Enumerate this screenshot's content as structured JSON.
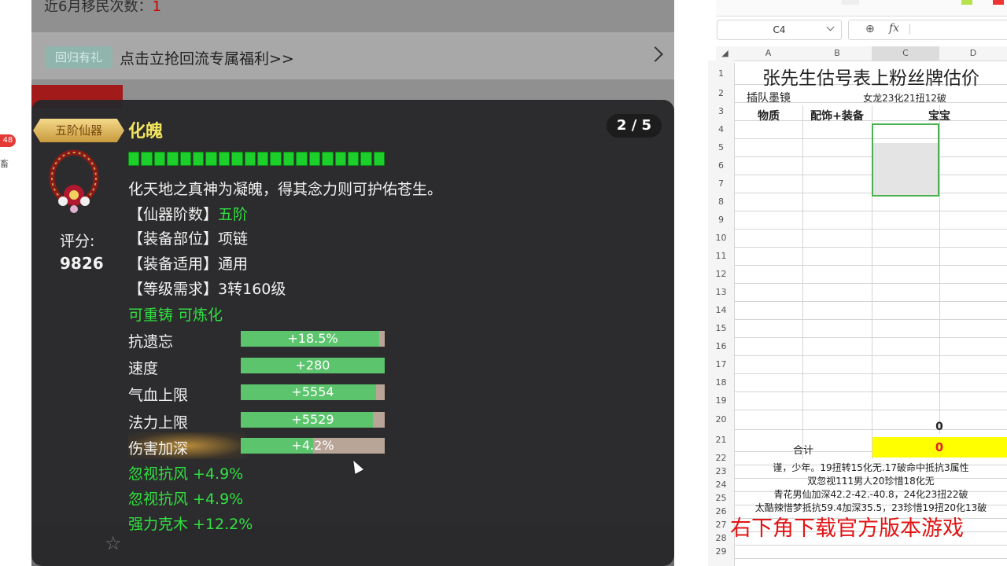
{
  "left_strip": {
    "badge": "48",
    "glyph": "畜"
  },
  "game_page": {
    "migrate_label": "近6月移民次数：",
    "migrate_value": "1",
    "return_tag": "回归有礼",
    "return_text": "点击立抢回流专属福利>>"
  },
  "tooltip": {
    "tier": "五阶仙器",
    "name": "化魄",
    "page": "2 / 5",
    "pip_count": 20,
    "description": "化天地之真神为凝魄，得其念力则可护佑苍生。",
    "score_label": "评分:",
    "score_value": "9826",
    "attributes": [
      {
        "label": "【仙器阶数】",
        "value": "五阶"
      },
      {
        "label": "【装备部位】",
        "value": "项链"
      },
      {
        "label": "【装备适用】",
        "value": "通用"
      },
      {
        "label": "【等级需求】",
        "value": "3转160级"
      }
    ],
    "recast": "可重铸 可炼化",
    "stats": [
      {
        "name": "抗遗忘",
        "value": "+18.5%",
        "fill": 0.96
      },
      {
        "name": "速度",
        "value": "+280",
        "fill": 1.0
      },
      {
        "name": "气血上限",
        "value": "+5554",
        "fill": 0.94
      },
      {
        "name": "法力上限",
        "value": "+5529",
        "fill": 0.92
      },
      {
        "name": "伤害加深",
        "value": "+4.2%",
        "fill": 0.5
      }
    ],
    "specials": [
      "忽视抗风 +4.9%",
      "忽视抗风 +4.9%",
      "强力克木 +12.2%"
    ],
    "colors": {
      "name": "#f2e55c",
      "green": "#30e040",
      "bar": "#5bc46c"
    }
  },
  "spreadsheet": {
    "name_box": "C4",
    "columns": [
      "A",
      "B",
      "C",
      "D"
    ],
    "rows": [
      "1",
      "2",
      "3",
      "4",
      "5",
      "6",
      "7",
      "8",
      "9",
      "10",
      "11",
      "12",
      "13",
      "14",
      "15",
      "16",
      "17",
      "18",
      "19",
      "20",
      "21",
      "22",
      "23",
      "24",
      "25",
      "26",
      "27",
      "28",
      "29"
    ],
    "title": "张先生估号表上粉丝牌估价",
    "row2_a": "插队墨镜",
    "row2_bcd": "女龙23化21扭12破",
    "row3": [
      "物质",
      "配饰+装备",
      "宝宝"
    ],
    "row20_c": "0",
    "total_label": "合计",
    "total_value": "0",
    "notes": [
      "谨，少年。19扭转15化无.17破命中抵抗3属性",
      "双忽视111男人20珍惜18化无",
      "青花男仙加深42.2-42.-40.8，24化23扭22破",
      "太酷辣惜梦抵抗59.4加深35.5，23珍惜19扭20化13破"
    ],
    "watermark": "右下角下载官方版本游戏"
  }
}
